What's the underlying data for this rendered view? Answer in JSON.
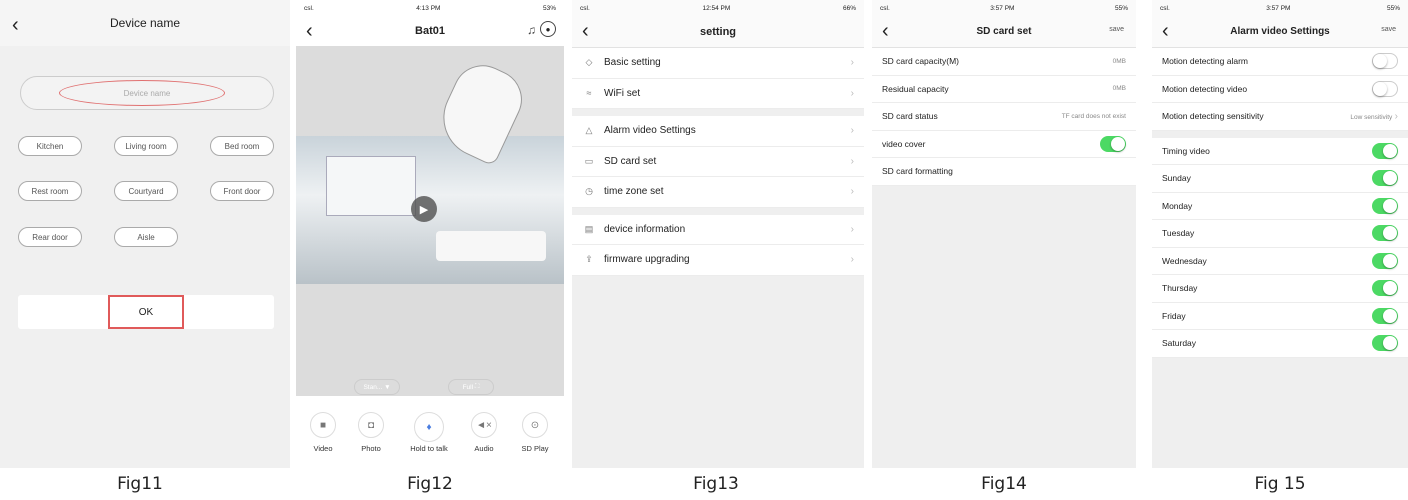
{
  "figures": [
    "Fig11",
    "Fig12",
    "Fig13",
    "Fig14",
    "Fig 15"
  ],
  "fig11": {
    "title": "Device name",
    "input_placeholder": "Device name",
    "rooms": [
      "Kitchen",
      "Living room",
      "Bed room",
      "Rest room",
      "Courtyard",
      "Front door",
      "Rear door",
      "Aisle"
    ],
    "ok_label": "OK"
  },
  "fig12": {
    "status": {
      "carrier": "csl.",
      "time": "4:13 PM",
      "battery": "53%"
    },
    "title": "Bat01",
    "quality_label": "Stan...",
    "full_label": "Full",
    "controls": [
      "Video",
      "Photo",
      "Hold to talk",
      "Audio",
      "SD Play"
    ]
  },
  "fig13": {
    "status": {
      "carrier": "csl.",
      "time": "12:54 PM",
      "battery": "66%"
    },
    "title": "setting",
    "groups": [
      [
        {
          "icon": "tag-icon",
          "glyph": "◇",
          "label": "Basic setting"
        },
        {
          "icon": "wifi-icon",
          "glyph": "≈",
          "label": "WiFi set"
        }
      ],
      [
        {
          "icon": "bell-icon",
          "glyph": "△",
          "label": "Alarm video Settings"
        },
        {
          "icon": "sd-card-icon",
          "glyph": "▭",
          "label": "SD card set"
        },
        {
          "icon": "clock-icon",
          "glyph": "◷",
          "label": "time zone set"
        }
      ],
      [
        {
          "icon": "info-icon",
          "glyph": "▤",
          "label": "device information"
        },
        {
          "icon": "upgrade-icon",
          "glyph": "⇪",
          "label": "firmware upgrading"
        }
      ]
    ]
  },
  "fig14": {
    "status": {
      "carrier": "csl.",
      "time": "3:57 PM",
      "battery": "55%"
    },
    "title": "SD card set",
    "save_label": "save",
    "rows": {
      "capacity": {
        "label": "SD card capacity(M)",
        "value": "0MB"
      },
      "residual": {
        "label": "Residual capacity",
        "value": "0MB"
      },
      "status": {
        "label": "SD card status",
        "value": "TF card does not exist"
      },
      "cover": {
        "label": "video cover",
        "on": true
      },
      "formatting": {
        "label": "SD card formatting"
      }
    }
  },
  "fig15": {
    "status": {
      "carrier": "csl.",
      "time": "3:57 PM",
      "battery": "55%"
    },
    "title": "Alarm video Settings",
    "save_label": "save",
    "motion_alarm": {
      "label": "Motion detecting alarm",
      "on": false
    },
    "motion_video": {
      "label": "Motion detecting video",
      "on": false
    },
    "sensitivity": {
      "label": "Motion detecting sensitivity",
      "value": "Low sensitivity"
    },
    "timing": [
      {
        "label": "Timing video",
        "on": true
      },
      {
        "label": "Sunday",
        "on": true
      },
      {
        "label": "Monday",
        "on": true
      },
      {
        "label": "Tuesday",
        "on": true
      },
      {
        "label": "Wednesday",
        "on": true
      },
      {
        "label": "Thursday",
        "on": true
      },
      {
        "label": "Friday",
        "on": true
      },
      {
        "label": "Saturday",
        "on": true
      }
    ]
  },
  "colors": {
    "toggle_on": "#4cd964",
    "highlight_red": "#e05a5a"
  }
}
